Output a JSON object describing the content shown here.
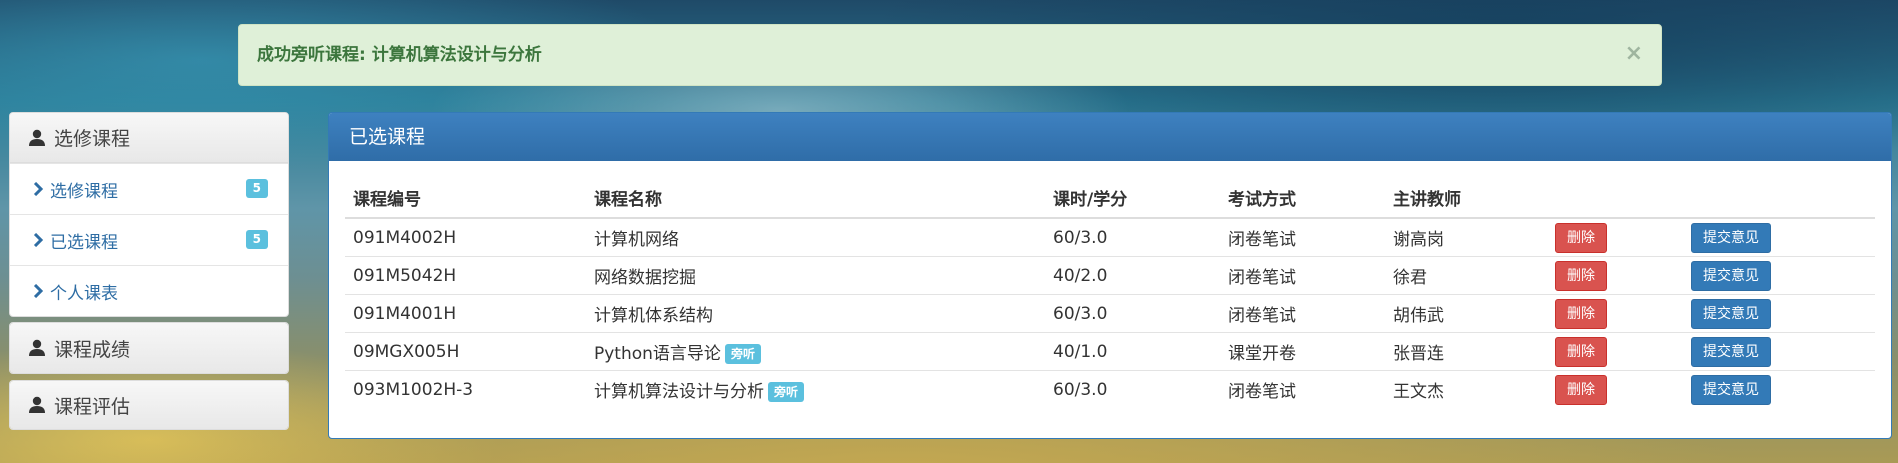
{
  "alert": {
    "message": "成功旁听课程: 计算机算法设计与分析",
    "close": "×"
  },
  "sidebar": {
    "elective": {
      "title": "选修课程",
      "items": [
        {
          "label": "选修课程",
          "badge": "5"
        },
        {
          "label": "已选课程",
          "badge": "5"
        },
        {
          "label": "个人课表"
        }
      ]
    },
    "grades": {
      "title": "课程成绩"
    },
    "evaluation": {
      "title": "课程评估"
    }
  },
  "panel": {
    "title": "已选课程",
    "columns": [
      "课程编号",
      "课程名称",
      "课时/学分",
      "考试方式",
      "主讲教师"
    ],
    "rows": [
      {
        "code": "091M4002H",
        "name": "计算机网络",
        "tag": "",
        "hours": "60/3.0",
        "exam": "闭卷笔试",
        "teacher": "谢高岗",
        "delete": "删除",
        "feedback": "提交意见"
      },
      {
        "code": "091M5042H",
        "name": "网络数据挖掘",
        "tag": "",
        "hours": "40/2.0",
        "exam": "闭卷笔试",
        "teacher": "徐君",
        "delete": "删除",
        "feedback": "提交意见"
      },
      {
        "code": "091M4001H",
        "name": "计算机体系结构",
        "tag": "",
        "hours": "60/3.0",
        "exam": "闭卷笔试",
        "teacher": "胡伟武",
        "delete": "删除",
        "feedback": "提交意见"
      },
      {
        "code": "09MGX005H",
        "name": "Python语言导论",
        "tag": "旁听",
        "hours": "40/1.0",
        "exam": "课堂开卷",
        "teacher": "张晋连",
        "delete": "删除",
        "feedback": "提交意见"
      },
      {
        "code": "093M1002H-3",
        "name": "计算机算法设计与分析",
        "tag": "旁听",
        "hours": "60/3.0",
        "exam": "闭卷笔试",
        "teacher": "王文杰",
        "delete": "删除",
        "feedback": "提交意见"
      }
    ]
  },
  "colors": {
    "alert_bg": "#dff0d8",
    "alert_text": "#3c763d",
    "panel_primary": "#337ab7",
    "danger": "#d9534f",
    "info": "#5bc0de"
  }
}
